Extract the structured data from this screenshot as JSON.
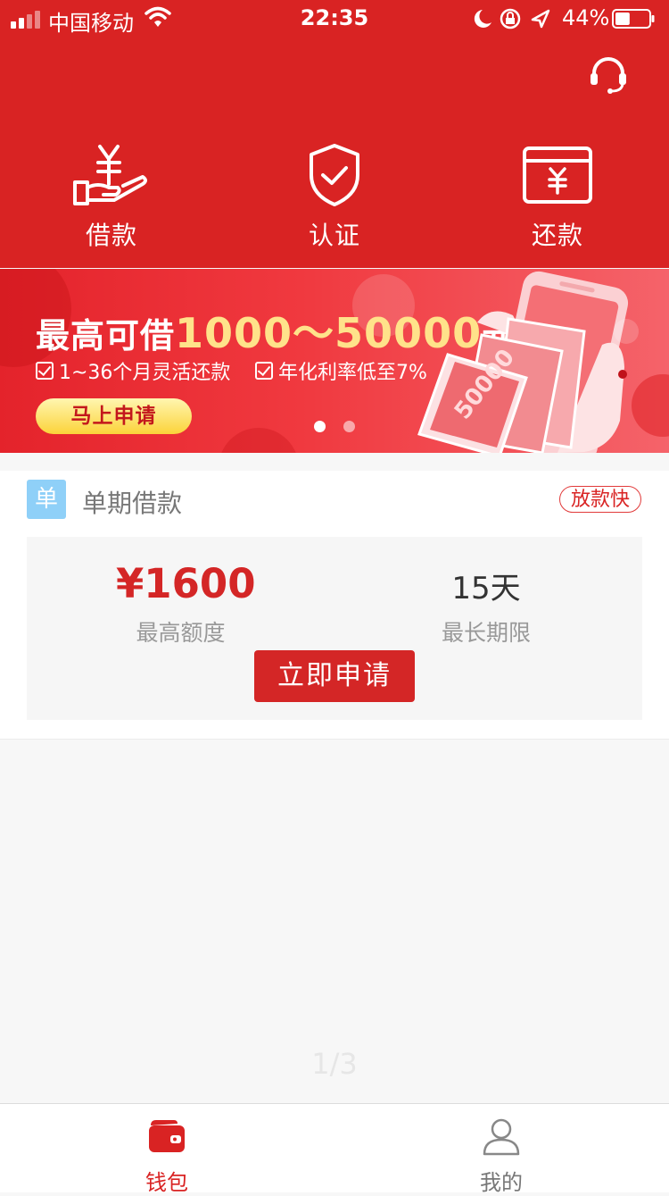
{
  "status_bar": {
    "carrier": "中国移动",
    "time": "22:35",
    "battery": "44%",
    "battery_level": 0.44
  },
  "quick_actions": [
    {
      "label": "借款",
      "icon": "hand-yuan-icon"
    },
    {
      "label": "认证",
      "icon": "shield-check-icon"
    },
    {
      "label": "还款",
      "icon": "card-yuan-icon"
    }
  ],
  "banner": {
    "title_pre": "最高可借",
    "title_range": "1000～50000",
    "title_post": "元",
    "feature_1": "1~36个月灵活还款",
    "feature_2": "年化利率低至7%",
    "button": "马上申请",
    "note_amount": "50000",
    "slides": 2,
    "active_slide": 1
  },
  "product": {
    "badge": "单",
    "name": "单期借款",
    "tag": "放款快",
    "amount": "¥1600",
    "amount_label": "最高额度",
    "period": "15天",
    "period_label": "最长期限",
    "apply": "立即申请"
  },
  "page_indicator": "1/3",
  "tabs": [
    {
      "label": "钱包",
      "icon": "wallet-icon",
      "active": true
    },
    {
      "label": "我的",
      "icon": "user-icon",
      "active": false
    }
  ],
  "colors": {
    "primary": "#d92323",
    "banner_highlight": "#ffe28a",
    "badge_blue": "#8fd0f8"
  }
}
